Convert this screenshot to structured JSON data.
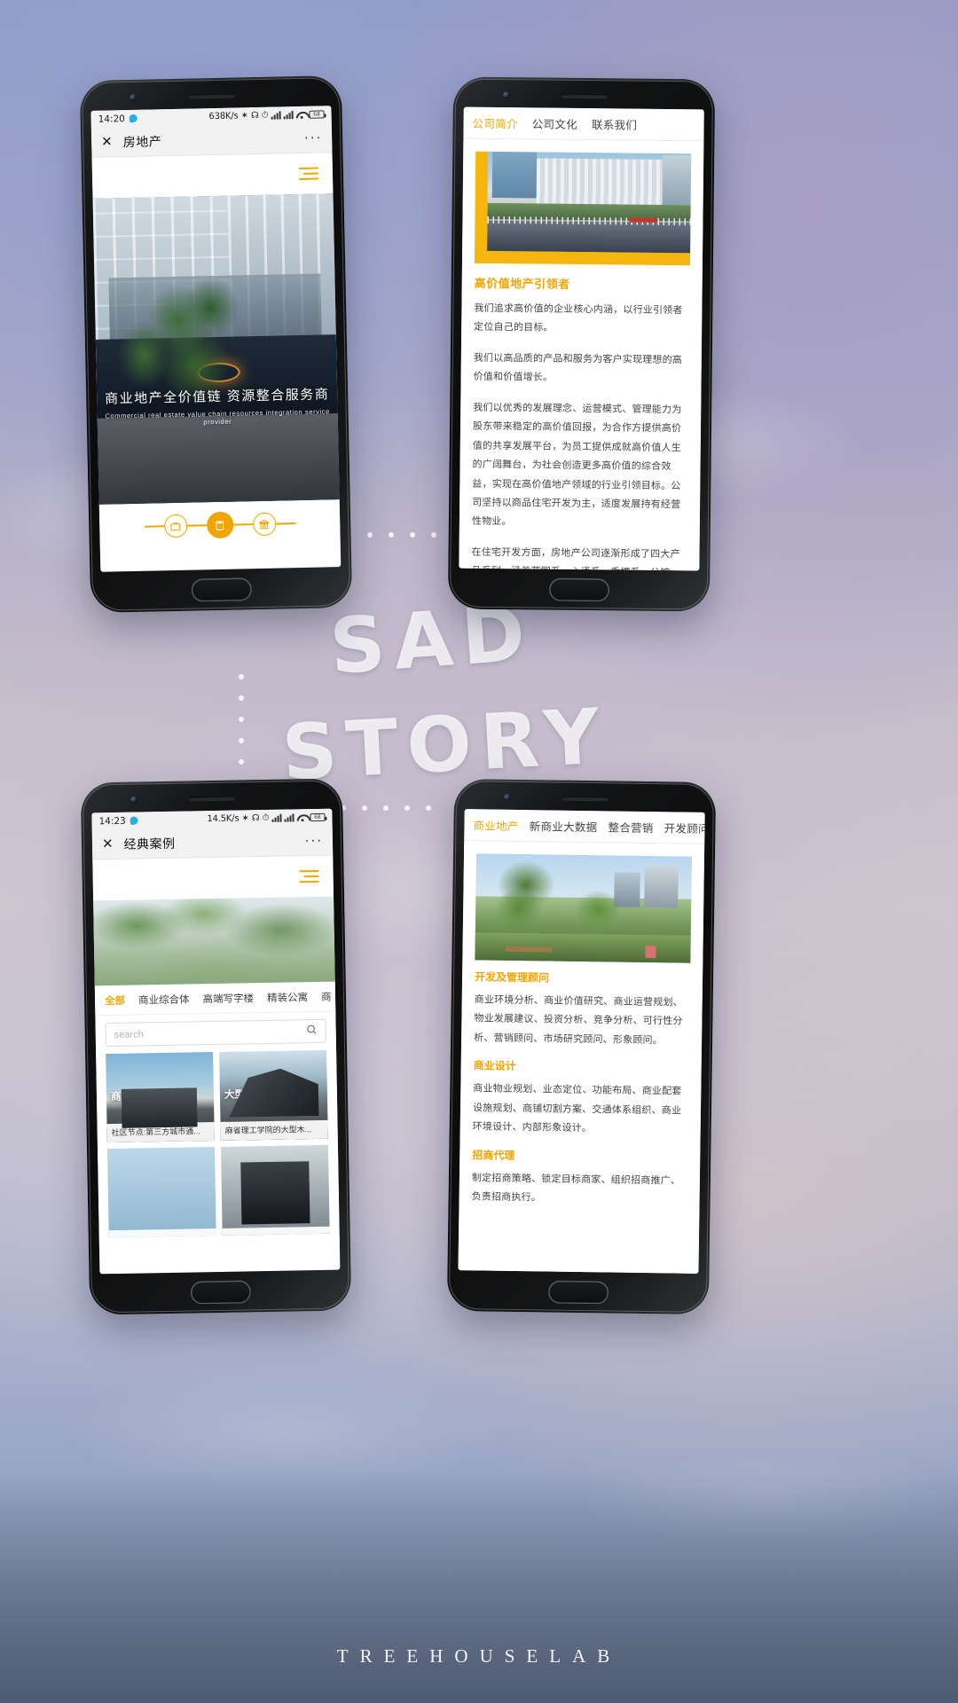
{
  "background": {
    "watermark_line1": "SAD",
    "watermark_line2": "STORY",
    "brand": "TREEHOUSELAB",
    "accent_color": "#f0a500",
    "yellow_block": "#f5b60d"
  },
  "phone1": {
    "status": {
      "time": "14:20",
      "speed": "638K/s",
      "battery": "68"
    },
    "nav": {
      "close_label": "✕",
      "title": "房地产",
      "more_label": "···"
    },
    "menu_icon": "hamburger-icon",
    "hero": {
      "caption_cn": "商业地产全价值链 资源整合服务商",
      "caption_en": "Commercial real estate value chain resources integration service provider"
    },
    "steps": [
      {
        "name": "briefcase-icon",
        "active": false
      },
      {
        "name": "clipboard-icon",
        "active": true
      },
      {
        "name": "bank-icon",
        "active": false
      }
    ]
  },
  "phone2": {
    "tabs": [
      {
        "label": "公司简介",
        "active": true
      },
      {
        "label": "公司文化",
        "active": false
      },
      {
        "label": "联系我们",
        "active": false
      }
    ],
    "heading": "高价值地产引领者",
    "paragraphs": [
      "我们追求高价值的企业核心内涵，以行业引领者定位自己的目标。",
      "我们以高品质的产品和服务为客户实现理想的高价值和价值增长。",
      "我们以优秀的发展理念、运营模式、管理能力为股东带来稳定的高价值回报，为合作方提供高价值的共享发展平台，为员工提供成就高价值人生的广阔舞台，为社会创造更多高价值的综合效益，实现在高价值地产领域的行业引领目标。公司坚持以商品住宅开发为主，适度发展持有经营性物业。",
      "在住宅开发方面，房地产公司逐渐形成了四大产品系列，涵盖花园系、心语系、香檟系、公馆系、林语系、"
    ]
  },
  "phone3": {
    "status": {
      "time": "14:23",
      "speed": "14.5K/s",
      "battery": "68"
    },
    "nav": {
      "close_label": "✕",
      "title": "经典案例",
      "more_label": "···"
    },
    "menu_icon": "hamburger-icon",
    "categories": [
      {
        "label": "全部",
        "active": true
      },
      {
        "label": "商业综合体",
        "active": false
      },
      {
        "label": "高端写字楼",
        "active": false
      },
      {
        "label": "精装公寓",
        "active": false
      },
      {
        "label": "商",
        "active": false
      }
    ],
    "search": {
      "placeholder": "search",
      "icon": "search-icon"
    },
    "cards": [
      {
        "title": "商业住宅",
        "caption": "社区节点:第三方城市通..."
      },
      {
        "title": "大型木材长建筑",
        "caption": "麻省理工学院的大型木..."
      },
      {
        "title": "",
        "caption": ""
      },
      {
        "title": "",
        "caption": ""
      }
    ]
  },
  "phone4": {
    "tabs": [
      {
        "label": "商业地产",
        "active": true
      },
      {
        "label": "新商业大数据",
        "active": false
      },
      {
        "label": "整合营销",
        "active": false
      },
      {
        "label": "开发顾问",
        "active": false
      }
    ],
    "sections": [
      {
        "heading": "开发及管理顾问",
        "body": "商业环境分析、商业价值研究、商业运营规划、物业发展建议、投资分析、竞争分析、可行性分析、营销顾问、市场研究顾问、形象顾问。"
      },
      {
        "heading": "商业设计",
        "body": "商业物业规划、业态定位、功能布局、商业配套设施规划、商铺切割方案、交通体系组织、商业环境设计、内部形象设计。"
      },
      {
        "heading": "招商代理",
        "body": "制定招商策略、锁定目标商家、组织招商推广、负责招商执行。"
      }
    ]
  }
}
